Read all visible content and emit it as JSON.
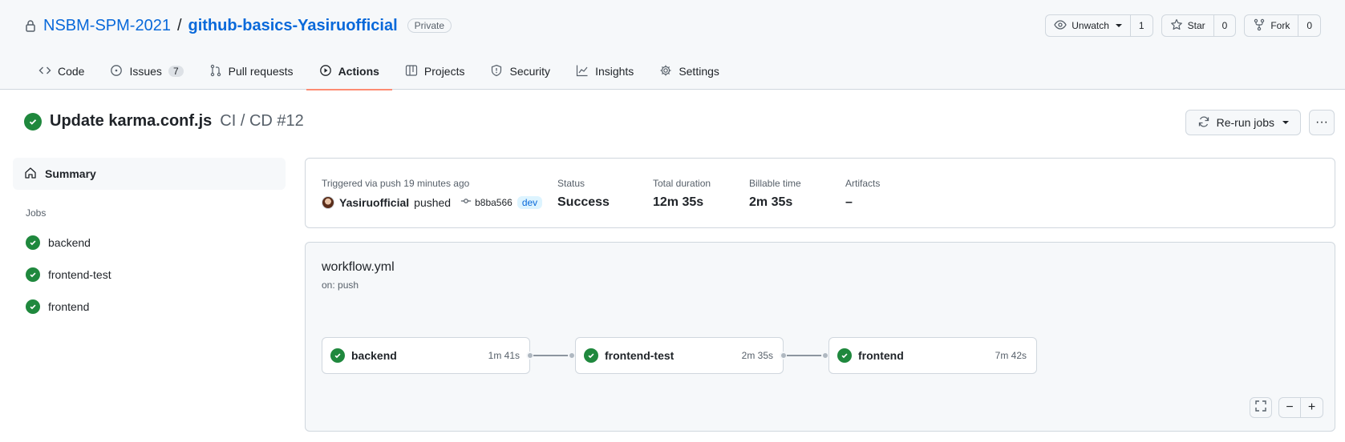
{
  "repo": {
    "owner": "NSBM-SPM-2021",
    "separator": "/",
    "name": "github-basics-Yasiruofficial",
    "visibility": "Private"
  },
  "repo_actions": {
    "watch_label": "Unwatch",
    "watch_count": "1",
    "star_label": "Star",
    "star_count": "0",
    "fork_label": "Fork",
    "fork_count": "0"
  },
  "tabs": [
    {
      "label": "Code",
      "icon": "code-icon"
    },
    {
      "label": "Issues",
      "icon": "issue-icon",
      "counter": "7"
    },
    {
      "label": "Pull requests",
      "icon": "pull-request-icon"
    },
    {
      "label": "Actions",
      "icon": "play-icon",
      "active": true
    },
    {
      "label": "Projects",
      "icon": "table-icon"
    },
    {
      "label": "Security",
      "icon": "shield-icon"
    },
    {
      "label": "Insights",
      "icon": "graph-icon"
    },
    {
      "label": "Settings",
      "icon": "gear-icon"
    }
  ],
  "run": {
    "title": "Update karma.conf.js",
    "workflow_label": "CI / CD #12",
    "rerun_label": "Re-run jobs",
    "more_label": "···"
  },
  "sidebar": {
    "summary_label": "Summary",
    "jobs_heading": "Jobs",
    "jobs": [
      {
        "label": "backend"
      },
      {
        "label": "frontend-test"
      },
      {
        "label": "frontend"
      }
    ]
  },
  "summary": {
    "trigger_text": "Triggered via push 19 minutes ago",
    "actor": "Yasiruofficial",
    "action": "pushed",
    "commit": "b8ba566",
    "branch": "dev",
    "status_label": "Status",
    "status_value": "Success",
    "duration_label": "Total duration",
    "duration_value": "12m 35s",
    "billable_label": "Billable time",
    "billable_value": "2m 35s",
    "artifacts_label": "Artifacts",
    "artifacts_value": "–"
  },
  "workflow": {
    "file": "workflow.yml",
    "trigger": "on: push",
    "jobs": [
      {
        "name": "backend",
        "time": "1m 41s"
      },
      {
        "name": "frontend-test",
        "time": "2m 35s"
      },
      {
        "name": "frontend",
        "time": "7m 42s"
      }
    ],
    "zoom": {
      "fullscreen": "⛶",
      "minus": "−",
      "plus": "+"
    }
  },
  "colors": {
    "success": "#1f883d",
    "link": "#0969da",
    "active_tab_underline": "#fd8c73"
  }
}
